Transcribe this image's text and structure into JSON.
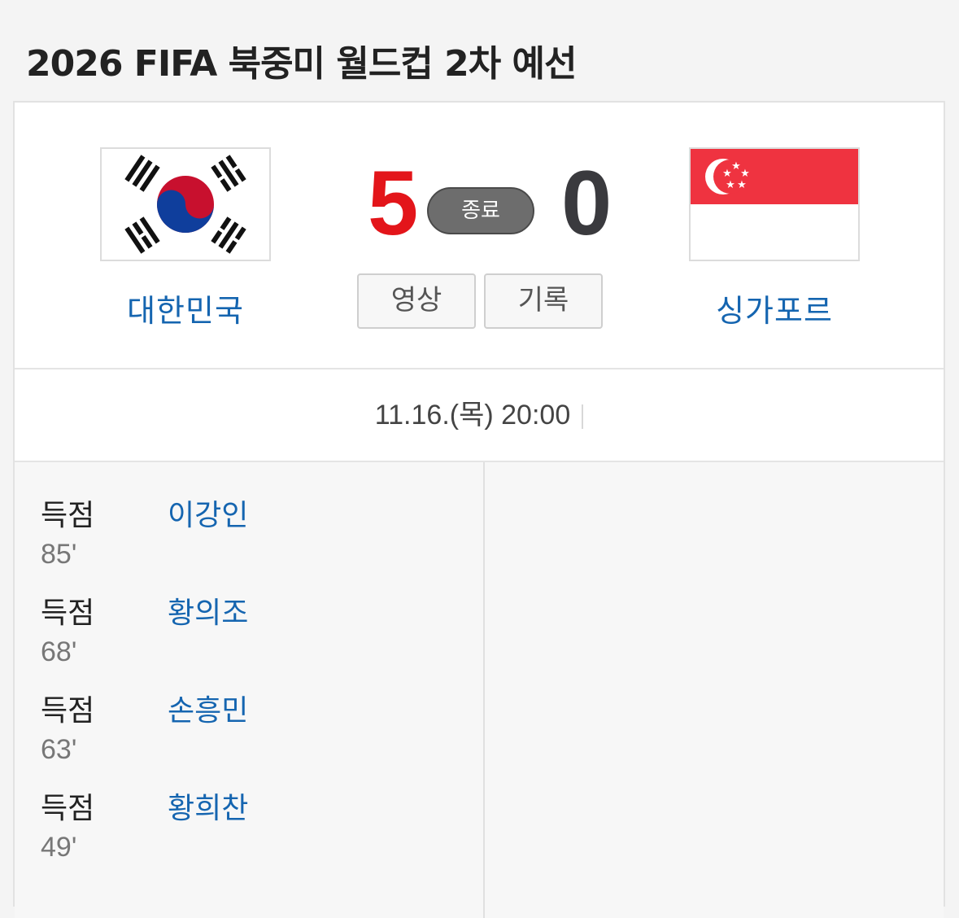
{
  "page_title": "2026 FIFA 북중미 월드컵 2차 예선",
  "match": {
    "home": {
      "name": "대한민국",
      "score": "5",
      "flag": "south-korea-flag"
    },
    "away": {
      "name": "싱가포르",
      "score": "0",
      "flag": "singapore-flag"
    },
    "status": "종료",
    "buttons": {
      "video": "영상",
      "record": "기록"
    },
    "datetime": "11.16.(목) 20:00"
  },
  "goals_home": [
    {
      "type": "득점",
      "player": "이강인",
      "minute": "85'"
    },
    {
      "type": "득점",
      "player": "황의조",
      "minute": "68'"
    },
    {
      "type": "득점",
      "player": "손흥민",
      "minute": "63'"
    },
    {
      "type": "득점",
      "player": "황희찬",
      "minute": "49'"
    }
  ],
  "colors": {
    "home_score": "#e3151a",
    "away_score": "#3a3a3e",
    "link": "#1565b0"
  }
}
